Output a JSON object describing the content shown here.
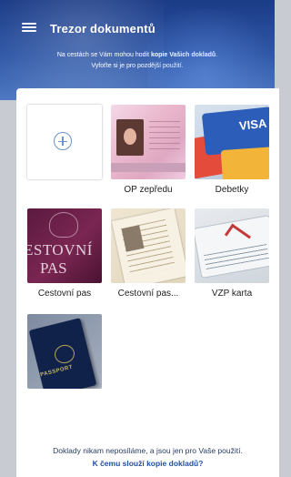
{
  "header": {
    "title": "Trezor dokumentů",
    "subtitle_part1": "Na cestách se Vám mohou hodit ",
    "subtitle_bold": "kopie Vašich dokladů",
    "subtitle_part2": ".",
    "subtitle_line2": "Vyfoťte si je pro pozdější použití."
  },
  "documents": [
    {
      "label": "",
      "icon": "plus-circle-icon"
    },
    {
      "label": "OP zepředu"
    },
    {
      "label": "Debetky"
    },
    {
      "label": "Cestovní pas"
    },
    {
      "label": "Cestovní pas..."
    },
    {
      "label": "VZP karta"
    },
    {
      "label": ""
    }
  ],
  "thumb_text": {
    "pas_line1": "ESTOVNÍ",
    "pas_line2": "PAS",
    "visa": "VISA",
    "passport": "PASSPORT"
  },
  "footer": {
    "note": "Doklady nikam neposíláme, a jsou jen pro Vaše použití.",
    "link": "K čemu slouží kopie dokladů?"
  },
  "colors": {
    "header_top": "#1b3b86",
    "header_bottom": "#4f79c2",
    "accent": "#1f4e9f",
    "plus_icon": "#6d93c8"
  }
}
